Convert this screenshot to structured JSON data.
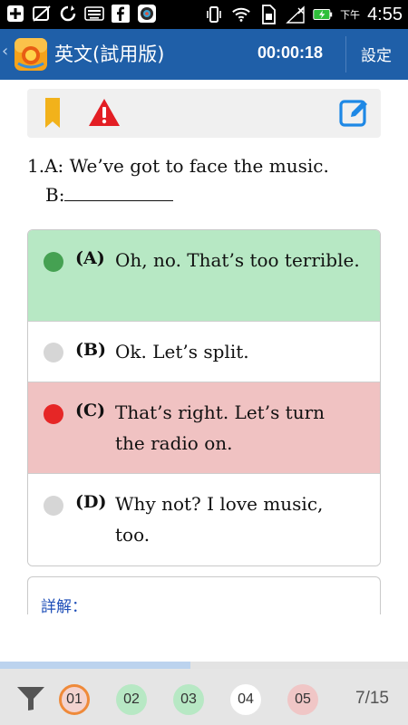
{
  "status_bar": {
    "icons": [
      "add-icon",
      "no-sim-icon",
      "sync-icon",
      "keyboard-icon",
      "facebook-icon",
      "camera-app-icon",
      "vibrate-icon",
      "wifi-icon",
      "sim-icon",
      "signal-icon",
      "battery-charging-icon"
    ],
    "ampm": "下午",
    "time": "4:55"
  },
  "app_bar": {
    "back_glyph": "‹",
    "title": "英文(試用版)",
    "timer": "00:00:18",
    "settings_label": "設定"
  },
  "toolbar": {
    "icons": [
      "bookmark-icon",
      "warning-icon",
      "edit-icon"
    ],
    "bookmark_color": "#f2b21b",
    "warning_color": "#e31e24",
    "edit_color": "#1e88e5"
  },
  "question": {
    "line1": "1.A: We’ve got to face the music.",
    "line2_prefix": "B:"
  },
  "options": [
    {
      "key": "(A)",
      "text": "Oh, no. That’s too terrible.",
      "state": "correct"
    },
    {
      "key": "(B)",
      "text": "Ok. Let’s split.",
      "state": "none"
    },
    {
      "key": "(C)",
      "text": "That’s right. Let’s turn the radio on.",
      "state": "wrong"
    },
    {
      "key": "(D)",
      "text": "Why not? I love music, too.",
      "state": "none"
    }
  ],
  "explanation": {
    "label": "詳解："
  },
  "progress": {
    "fraction": 0.4667
  },
  "bottom_bar": {
    "question_numbers": [
      {
        "label": "01",
        "state": "current"
      },
      {
        "label": "02",
        "state": "correct"
      },
      {
        "label": "03",
        "state": "correct"
      },
      {
        "label": "04",
        "state": "unanswered"
      },
      {
        "label": "05",
        "state": "wrong"
      }
    ],
    "page_count": "7/15"
  },
  "colors": {
    "app_bar": "#1f5fa8",
    "correct_bg": "#b7e8c4",
    "wrong_bg": "#f0c2c2",
    "correct_dot": "#45a152",
    "wrong_dot": "#e62626",
    "explain_label": "#1f4fb8"
  }
}
